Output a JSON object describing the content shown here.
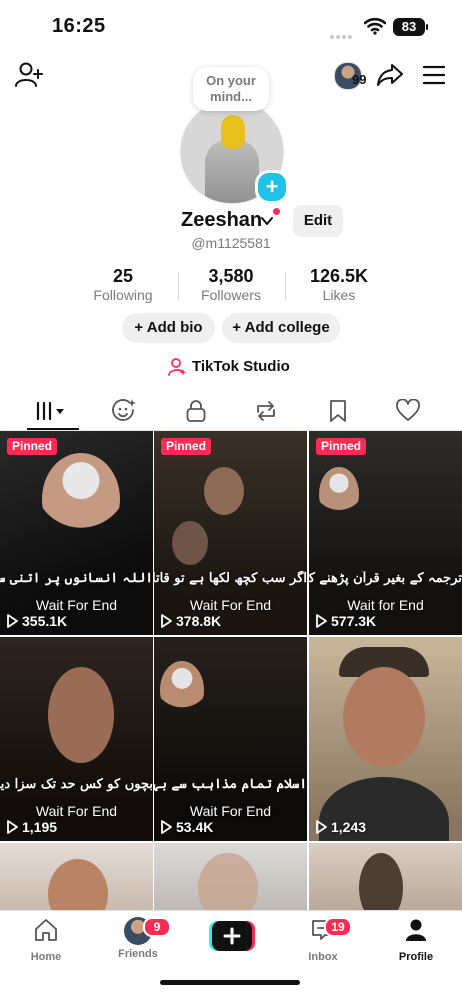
{
  "status_bar": {
    "time": "16:25",
    "battery": "83"
  },
  "top_bar": {
    "story_count": "99"
  },
  "profile": {
    "note_bubble": "On your mind...",
    "name": "Zeeshan",
    "edit_label": "Edit",
    "handle": "@m1125581",
    "stats": [
      {
        "value": "25",
        "label": "Following"
      },
      {
        "value": "3,580",
        "label": "Followers"
      },
      {
        "value": "126.5K",
        "label": "Likes"
      }
    ],
    "add_bio_label": "+ Add bio",
    "add_college_label": "+ Add college",
    "studio_label": "TikTok Studio"
  },
  "tabs": [
    "videos",
    "liked-by-others",
    "private",
    "reposts",
    "favorites",
    "liked"
  ],
  "videos": [
    {
      "pinned": "Pinned",
      "caption": "اللہ انسانوں پر اتنی سختیاں کیوں کرتا ہے",
      "watermark": "Wait For End",
      "views": "355.1K"
    },
    {
      "pinned": "Pinned",
      "caption": "اگر سب کچھ لکھا ہے تو قاتل مجرم کیوں",
      "watermark": "Wait For End",
      "views": "378.8K"
    },
    {
      "pinned": "Pinned",
      "caption": "ترجمہ کے بغیر قرآن پڑھنے کا کیا فائدہ",
      "watermark": "Wait for End",
      "views": "577.3K"
    },
    {
      "pinned": "",
      "caption": "بچوں کو کس حد تک سزا دینی چاہیے",
      "watermark": "Wait For End",
      "views": "1,195"
    },
    {
      "pinned": "",
      "caption": "اسلام تمام مذاہب سے بہتر ہے",
      "watermark": "Wait For End",
      "views": "53.4K"
    },
    {
      "pinned": "",
      "caption": "",
      "watermark": "",
      "views": "1,243"
    },
    {
      "pinned": "",
      "caption": "",
      "watermark": "",
      "views": ""
    },
    {
      "pinned": "",
      "caption": "",
      "watermark": "",
      "views": ""
    },
    {
      "pinned": "",
      "caption": "",
      "watermark": "",
      "views": ""
    }
  ],
  "bottom_nav": {
    "home": "Home",
    "friends": "Friends",
    "friends_badge": "9",
    "inbox": "Inbox",
    "inbox_badge": "19",
    "profile": "Profile"
  },
  "colors": {
    "accent": "#fe2c55",
    "add_photo": "#20c3e6"
  }
}
